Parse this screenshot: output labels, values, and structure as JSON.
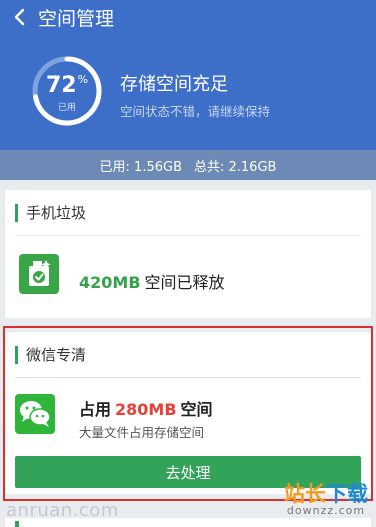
{
  "nav": {
    "title": "空间管理"
  },
  "summary": {
    "percent": "72",
    "percent_symbol": "%",
    "percent_label": "已用",
    "percent_value": 0.72,
    "title": "存储空间充足",
    "subtitle": "空间状态不错，请继续保持"
  },
  "stats": {
    "used": "已用: 1.56GB",
    "total": "总共: 2.16GB"
  },
  "junk_card": {
    "title": "手机垃圾",
    "freed_amount": "420MB",
    "freed_text": "空间已释放"
  },
  "wechat_card": {
    "title": "微信专清",
    "occupied_prefix": "占用",
    "occupied_amount": "280MB",
    "occupied_suffix": "空间",
    "description": "大量文件占用存储空间",
    "button_label": "去处理"
  },
  "watermark": {
    "left": "anruan.com",
    "right_part1": "站长",
    "right_part2": "下载",
    "right_sub": "downzz.com"
  },
  "colors": {
    "header": "#3d6fc8",
    "stats_bar": "#6d8ab6",
    "green": "#33a35a",
    "red": "#e8413a",
    "highlight_border": "#d9322e"
  }
}
